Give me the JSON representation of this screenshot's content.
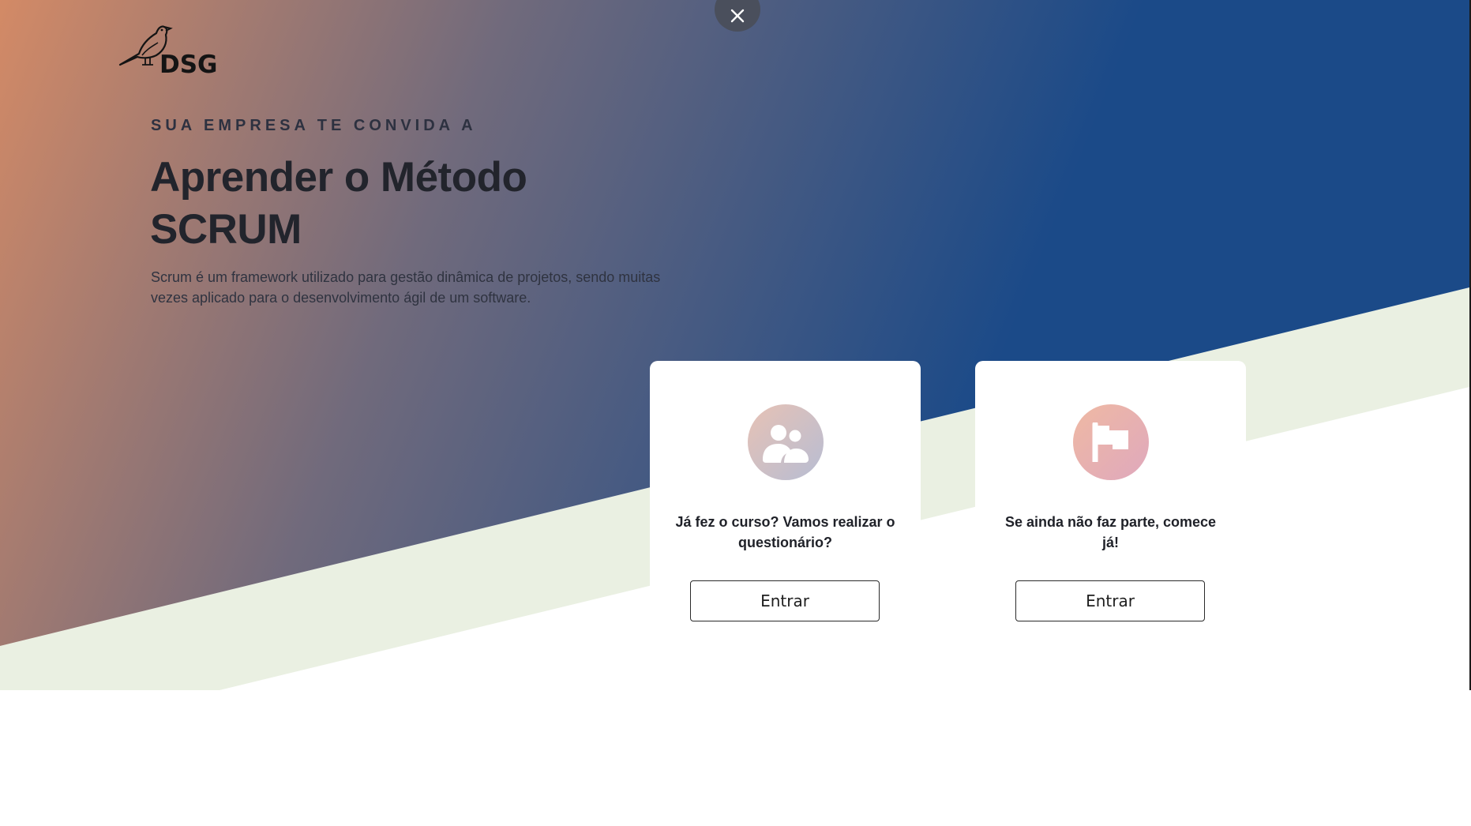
{
  "logo": {
    "text": "DSG",
    "icon": "bird-icon"
  },
  "close": {
    "icon": "close-icon"
  },
  "hero": {
    "eyebrow": "SUA EMPRESA TE CONVIDA A",
    "title": "Aprender o Método SCRUM",
    "description": "Scrum é um framework utilizado para gestão dinâmica de projetos, sendo muitas vezes aplicado para o desenvolvimento ágil de um software."
  },
  "cards": [
    {
      "icon": "people-icon",
      "text": "Já fez o curso? Vamos realizar o questionário?",
      "button": "Entrar"
    },
    {
      "icon": "flag-icon",
      "text": "Se ainda não faz parte, comece já!",
      "button": "Entrar"
    }
  ],
  "colors": {
    "gradient_start": "#d38a66",
    "gradient_end": "#1b4a88",
    "stripe": "#eaf0e2",
    "text_dark": "#22242c"
  }
}
